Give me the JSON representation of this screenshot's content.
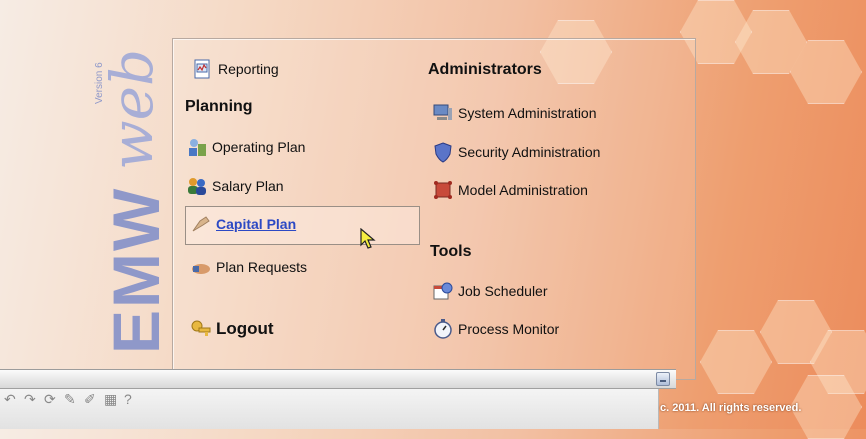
{
  "logo": {
    "wordmark": "EMW",
    "script": "web",
    "version": "Version 6"
  },
  "menu": {
    "reporting": "Reporting",
    "planning_heading": "Planning",
    "planning_items": [
      "Operating Plan",
      "Salary Plan",
      "Capital Plan",
      "Plan Requests"
    ],
    "logout": "Logout",
    "admin_heading": "Administrators",
    "admin_items": [
      "System Administration",
      "Security Administration",
      "Model Administration"
    ],
    "tools_heading": "Tools",
    "tools_items": [
      "Job Scheduler",
      "Process Monitor"
    ]
  },
  "footer": {
    "copyright": "c. 2011. All rights reserved."
  },
  "colors": {
    "link": "#2c49c4",
    "logo": "#8f98c9"
  }
}
